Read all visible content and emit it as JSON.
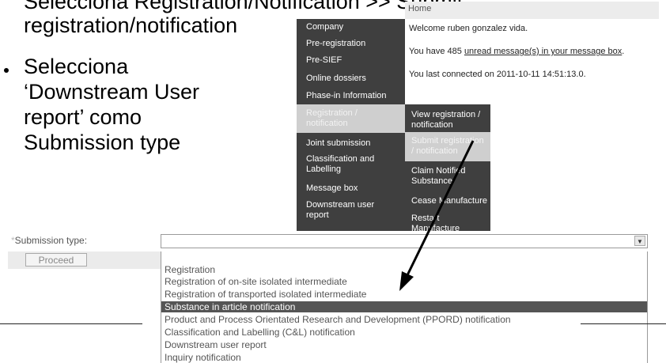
{
  "slide": {
    "top_line": "Selecciona Registration/Notification >> Submit",
    "line2": "registration/notification",
    "bullet2_lines": [
      "Selecciona",
      "‘Downstream User",
      "report’ como",
      "Submission type"
    ]
  },
  "portal": {
    "home": "Home",
    "nav_items": [
      "Company",
      "Pre-registration",
      "Pre-SIEF",
      "Online dossiers",
      "Phase-in Information",
      "Registration /\nnotification",
      "Joint submission",
      "Classification and\nLabelling",
      "Message box",
      "Downstream user\nreport"
    ],
    "sub_items": [
      "View registration /\nnotification",
      "Submit registration\n/ notification",
      "Claim Notified\nSubstance",
      "Cease Manufacture",
      "Restart\nManufacture"
    ],
    "welcome": "Welcome ruben gonzalez vida.",
    "messages_pre": "You have 485 ",
    "messages_link": "unread message(s) in your message box",
    "messages_post": ".",
    "last_connected": "You last connected on 2011-10-11 14:51:13.0."
  },
  "form": {
    "required_mark": "*",
    "label": "Submission type:",
    "select_value": "",
    "proceed_label": "Proceed",
    "options": [
      "Registration",
      "Registration of on-site isolated intermediate",
      "Registration of transported isolated intermediate",
      "Substance in article notification",
      "Product and Process Orientated Research and Development (PPORD) notification",
      "Classification and Labelling (C&L) notification",
      "Downstream user report",
      "Inquiry notification"
    ],
    "highlighted_option": "Substance in article notification"
  },
  "colors": {
    "nav_bg": "#3f3f3f",
    "nav_selected": "#cfcfcf",
    "option_highlight": "#555555"
  }
}
